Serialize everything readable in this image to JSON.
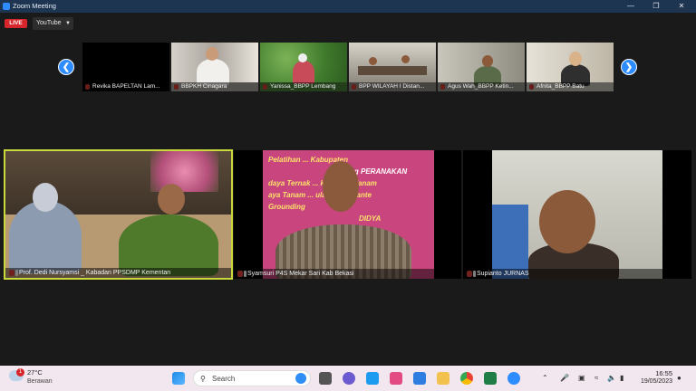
{
  "window": {
    "title": "Zoom Meeting"
  },
  "toolbar": {
    "live_label": "LIVE",
    "stream_target": "YouTube"
  },
  "gallery": {
    "thumbnails": [
      {
        "name": "Revika BAPELTAN Lam..."
      },
      {
        "name": "BBPKH Cinagara"
      },
      {
        "name": "Yanissa_BBPP Lembang"
      },
      {
        "name": "BPP WILAYAH I  Distan..."
      },
      {
        "name": "Agus Wah_BBPP Ketin..."
      },
      {
        "name": "Afnita_BBPP Batu"
      }
    ],
    "main_tiles": [
      {
        "name": "Prof. Dedi Nursyamsi _ Kabadan PPSDMP Kementan"
      },
      {
        "name": "Syamsuri P4S Mekar Sari Kab Bekasi"
      },
      {
        "name": "Supianto JURNAS"
      }
    ],
    "banner_lines": [
      "Pelatihan ... Kabupaten",
      "ng PERANAKAN",
      "daya Ternak ... kultura & Tanam",
      "aya Tanam ... ulampot / Plante",
      "Grounding",
      "DIDYA"
    ]
  },
  "taskbar": {
    "weather_temp": "27°C",
    "weather_desc": "Berawan",
    "weather_badge": "1",
    "search_placeholder": "Search",
    "time": "16:55",
    "date": "19/05/2023"
  }
}
